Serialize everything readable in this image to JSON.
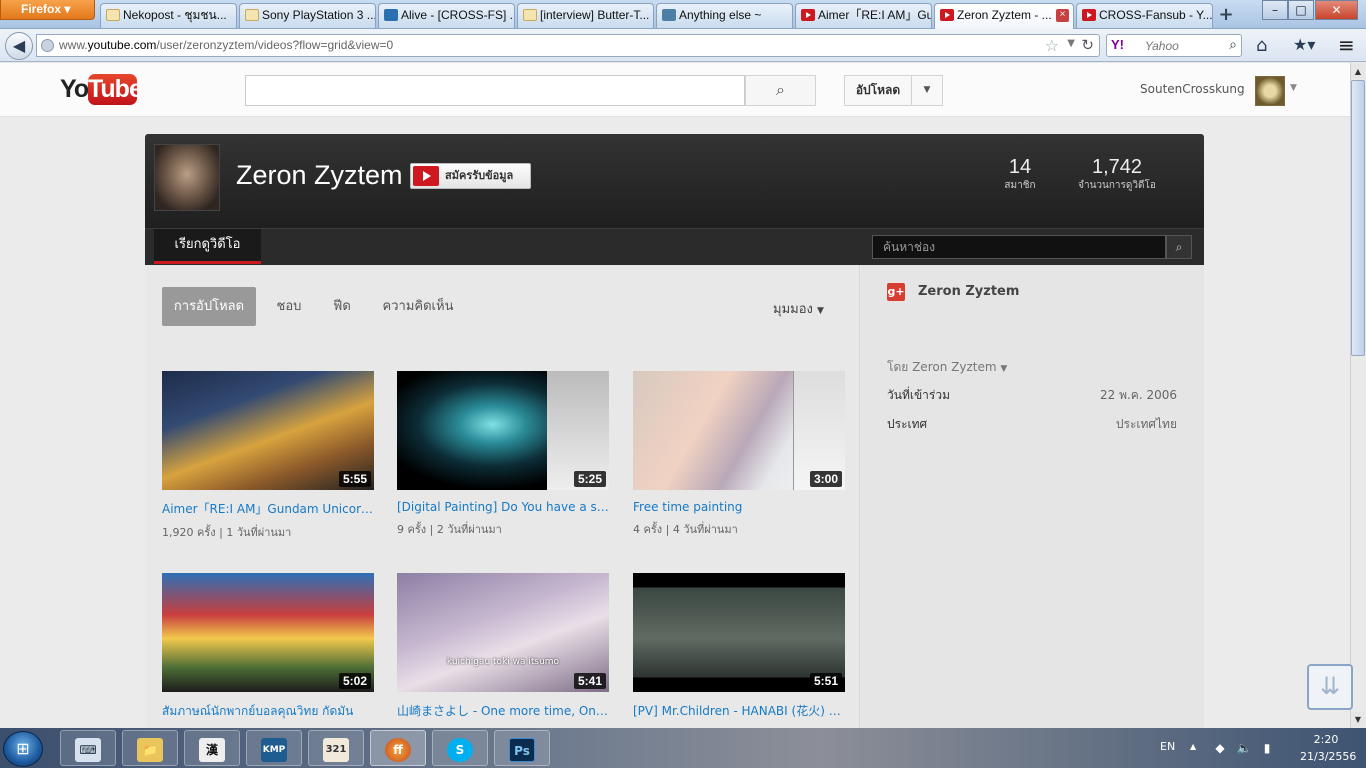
{
  "browser": {
    "app_button": "Firefox",
    "tabs": [
      {
        "label": "Nekopost - ชุมชน...",
        "icon": "page-icon"
      },
      {
        "label": "Sony PlayStation 3 ...",
        "icon": "page-icon"
      },
      {
        "label": "Alive - [CROSS-FS] ...",
        "icon": "site-icon"
      },
      {
        "label": "[interview] Butter-T...",
        "icon": "page-icon"
      },
      {
        "label": "Anything else ~",
        "icon": "site-icon"
      },
      {
        "label": "Aimer「RE:I AM」Gu...",
        "icon": "youtube-icon"
      },
      {
        "label": "Zeron Zyztem - ...",
        "icon": "youtube-icon",
        "active": true
      },
      {
        "label": "CROSS-Fansub - Y...",
        "icon": "youtube-icon"
      }
    ],
    "new_tab": "+",
    "url_prefix": "www.",
    "url_domain": "youtube.com",
    "url_path": "/user/zeronzyztem/videos?flow=grid&view=0",
    "search_engine_logo": "Y!",
    "search_engine": "Yahoo",
    "window_controls": {
      "minimize": "–",
      "maximize": "□",
      "close": "✕"
    }
  },
  "youtube": {
    "logo_you": "You",
    "logo_tube": "Tube",
    "search_placeholder": "",
    "upload_label": "อัปโหลด",
    "username": "SoutenCrosskung"
  },
  "channel": {
    "title": "Zeron Zyztem",
    "subscribe_label": "สมัครรับข้อมูล",
    "subscribers": "14",
    "subscribers_label": "สมาชิก",
    "views": "1,742",
    "views_label": "จำนวนการดูวิดีโอ",
    "nav_browse": "เรียกดูวิดีโอ",
    "search_placeholder": "ค้นหาช่อง",
    "tabs": [
      "การอัปโหลด",
      "ชอบ",
      "ฟีด",
      "ความคิดเห็น"
    ],
    "view_menu": "มุมมอง",
    "videos": [
      {
        "title": "Aimer「RE:I AM」Gundam Unicorn E...",
        "views": "1,920 ครั้ง",
        "age": "1 วันที่ผ่านมา",
        "duration": "5:55"
      },
      {
        "title": "[Digital Painting] Do You have a soul?",
        "views": "9 ครั้ง",
        "age": "2 วันที่ผ่านมา",
        "duration": "5:25"
      },
      {
        "title": "Free time painting",
        "views": "4 ครั้ง",
        "age": "4 วันที่ผ่านมา",
        "duration": "3:00"
      },
      {
        "title": "สัมภาษณ์นักพากย์บอลคุณวิทย กัดมัน",
        "views": "",
        "age": "",
        "duration": "5:02"
      },
      {
        "title": "山崎まさよし - One more time, One ...",
        "views": "",
        "age": "",
        "duration": "5:41",
        "subtitle1": "kuichigau toki wa itsumo"
      },
      {
        "title": "[PV] Mr.Children - HANABI (花火) - S...",
        "views": "",
        "age": "",
        "duration": "5:51"
      }
    ],
    "side": {
      "gplus_label": "g+",
      "name": "Zeron Zyztem",
      "by_line": "โดย Zeron Zyztem",
      "joined_key": "วันที่เข้าร่วม",
      "joined_value": "22 พ.ค. 2006",
      "country_key": "ประเทศ",
      "country_value": "ประเทศไทย"
    }
  },
  "taskbar": {
    "apps": [
      {
        "name": "keyboard-app",
        "glyph": "⌨"
      },
      {
        "name": "explorer-app",
        "glyph": "📁"
      },
      {
        "name": "kanji-app",
        "glyph": "漢"
      },
      {
        "name": "kmplayer-app",
        "glyph": "KMP"
      },
      {
        "name": "media-player-classic-app",
        "glyph": "321"
      },
      {
        "name": "firefox-app",
        "glyph": "ff"
      },
      {
        "name": "skype-app",
        "glyph": "S"
      },
      {
        "name": "photoshop-app",
        "glyph": "Ps"
      }
    ],
    "language": "EN",
    "time": "2:20",
    "date": "21/3/2556"
  },
  "colors": {
    "accent_red": "#cc181e",
    "link_blue": "#167ac6",
    "channel_header": "#2b2b2b"
  }
}
